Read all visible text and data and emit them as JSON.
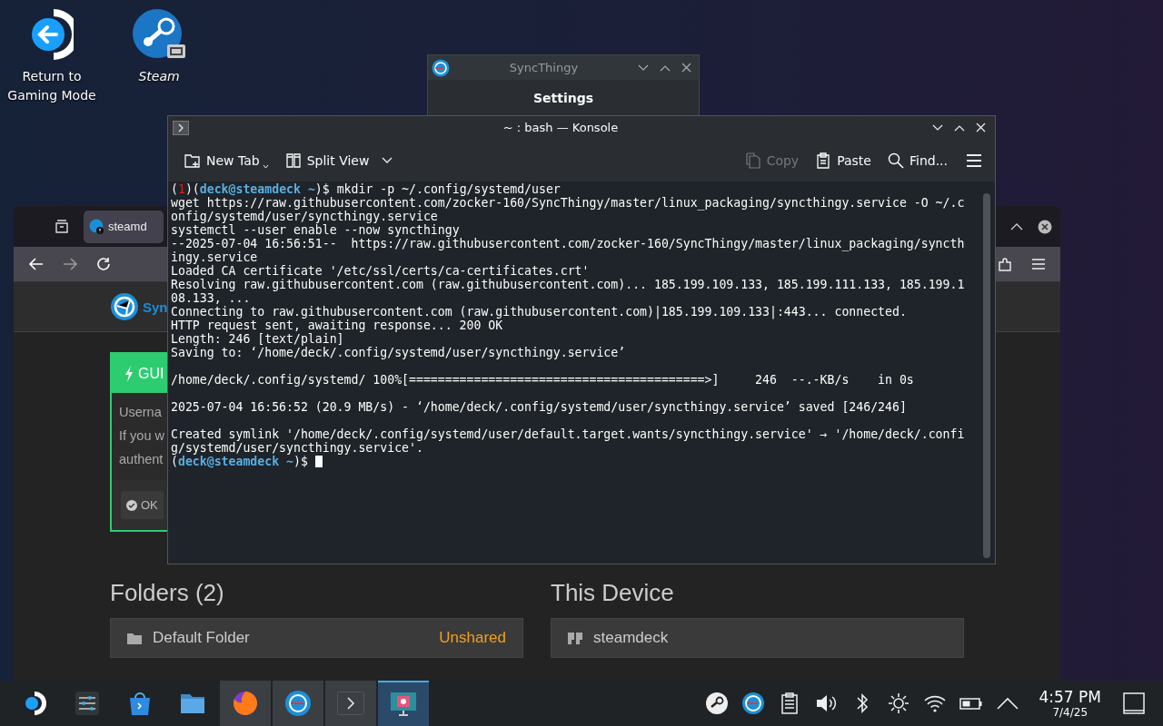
{
  "desktop_icons": [
    {
      "kind": "return",
      "label": "Return to Gaming Mode"
    },
    {
      "kind": "steam",
      "label": "Steam"
    }
  ],
  "browser": {
    "tab": {
      "label": "steamd"
    },
    "site_name": "Syn",
    "alert": {
      "title": "GUI",
      "lines": [
        "Userna",
        "If you w",
        "authent"
      ],
      "ok_button": "OK"
    },
    "folders": {
      "heading": "Folders (2)",
      "items": [
        {
          "name": "Default Folder",
          "status": "Unshared"
        }
      ]
    },
    "device": {
      "heading": "This Device",
      "items": [
        {
          "name": "steamdeck"
        }
      ]
    }
  },
  "syncthingy_window": {
    "title": "SyncThingy",
    "heading": "Settings"
  },
  "konsole": {
    "title": "~ : bash — Konsole",
    "toolbar": [
      {
        "kind": "new-tab",
        "label": "New Tab",
        "disabled": false
      },
      {
        "kind": "split",
        "label": "Split View",
        "disabled": false
      },
      {
        "kind": "copy",
        "label": "Copy",
        "disabled": true
      },
      {
        "kind": "paste",
        "label": "Paste",
        "disabled": false
      },
      {
        "kind": "find",
        "label": "Find...",
        "disabled": false
      }
    ],
    "lines": [
      {
        "kind": "prompt",
        "cursor": false,
        "segments": [
          {
            "kind": "plain",
            "text": "("
          },
          {
            "kind": "status",
            "text": "1"
          },
          {
            "kind": "plain",
            "text": ")("
          },
          {
            "kind": "user",
            "text": "deck@steamdeck"
          },
          {
            "kind": "dir",
            "text": " ~"
          },
          {
            "kind": "plain",
            "text": ")$ mkdir -p ~/.config/systemd/user"
          }
        ]
      },
      {
        "kind": "output",
        "cursor": false,
        "text": "wget https://raw.githubusercontent.com/zocker-160/SyncThingy/master/linux_packaging/syncthingy.service -O ~/.c"
      },
      {
        "kind": "output",
        "cursor": false,
        "text": "onfig/systemd/user/syncthingy.service"
      },
      {
        "kind": "output",
        "cursor": false,
        "text": "systemctl --user enable --now syncthingy"
      },
      {
        "kind": "output",
        "cursor": false,
        "text": "--2025-07-04 16:56:51--  https://raw.githubusercontent.com/zocker-160/SyncThingy/master/linux_packaging/syncth"
      },
      {
        "kind": "output",
        "cursor": false,
        "text": "ingy.service"
      },
      {
        "kind": "output",
        "cursor": false,
        "text": "Loaded CA certificate '/etc/ssl/certs/ca-certificates.crt'"
      },
      {
        "kind": "output",
        "cursor": false,
        "text": "Resolving raw.githubusercontent.com (raw.githubusercontent.com)... 185.199.109.133, 185.199.111.133, 185.199.1"
      },
      {
        "kind": "output",
        "cursor": false,
        "text": "08.133, ..."
      },
      {
        "kind": "output",
        "cursor": false,
        "text": "Connecting to raw.githubusercontent.com (raw.githubusercontent.com)|185.199.109.133|:443... connected."
      },
      {
        "kind": "output",
        "cursor": false,
        "text": "HTTP request sent, awaiting response... 200 OK"
      },
      {
        "kind": "output",
        "cursor": false,
        "text": "Length: 246 [text/plain]"
      },
      {
        "kind": "output",
        "cursor": false,
        "text": "Saving to: ‘/home/deck/.config/systemd/user/syncthingy.service’"
      },
      {
        "kind": "blank"
      },
      {
        "kind": "output",
        "cursor": false,
        "text": "/home/deck/.config/systemd/ 100%[=========================================>]     246  --.-KB/s    in 0s"
      },
      {
        "kind": "blank"
      },
      {
        "kind": "output",
        "cursor": false,
        "text": "2025-07-04 16:56:52 (20.9 MB/s) - ‘/home/deck/.config/systemd/user/syncthingy.service’ saved [246/246]"
      },
      {
        "kind": "blank"
      },
      {
        "kind": "output",
        "cursor": false,
        "text": "Created symlink '/home/deck/.config/systemd/user/default.target.wants/syncthingy.service' → '/home/deck/.confi"
      },
      {
        "kind": "output",
        "cursor": false,
        "text": "g/systemd/user/syncthingy.service'."
      },
      {
        "kind": "prompt",
        "cursor": true,
        "segments": [
          {
            "kind": "plain",
            "text": "("
          },
          {
            "kind": "user",
            "text": "deck@steamdeck"
          },
          {
            "kind": "dir",
            "text": " ~"
          },
          {
            "kind": "plain",
            "text": ")$"
          }
        ]
      }
    ]
  },
  "taskbar": {
    "tasks": [
      {
        "kind": "start",
        "open": false,
        "selected": false
      },
      {
        "kind": "mixer",
        "open": false,
        "selected": false
      },
      {
        "kind": "store",
        "open": false,
        "selected": false
      },
      {
        "kind": "files",
        "open": false,
        "selected": false
      },
      {
        "kind": "browser",
        "open": true,
        "selected": false
      },
      {
        "kind": "sync",
        "open": true,
        "selected": false
      },
      {
        "kind": "terminal",
        "open": true,
        "selected": false
      },
      {
        "kind": "screenshot",
        "open": true,
        "selected": true
      }
    ],
    "tray": [
      {
        "kind": "steam"
      },
      {
        "kind": "sync"
      },
      {
        "kind": "clipboard"
      },
      {
        "kind": "volume"
      },
      {
        "kind": "bluetooth"
      },
      {
        "kind": "brightness"
      },
      {
        "kind": "wifi"
      },
      {
        "kind": "battery"
      },
      {
        "kind": "expand"
      }
    ],
    "clock": {
      "time": "4:57 PM",
      "date": "7/4/25"
    }
  }
}
